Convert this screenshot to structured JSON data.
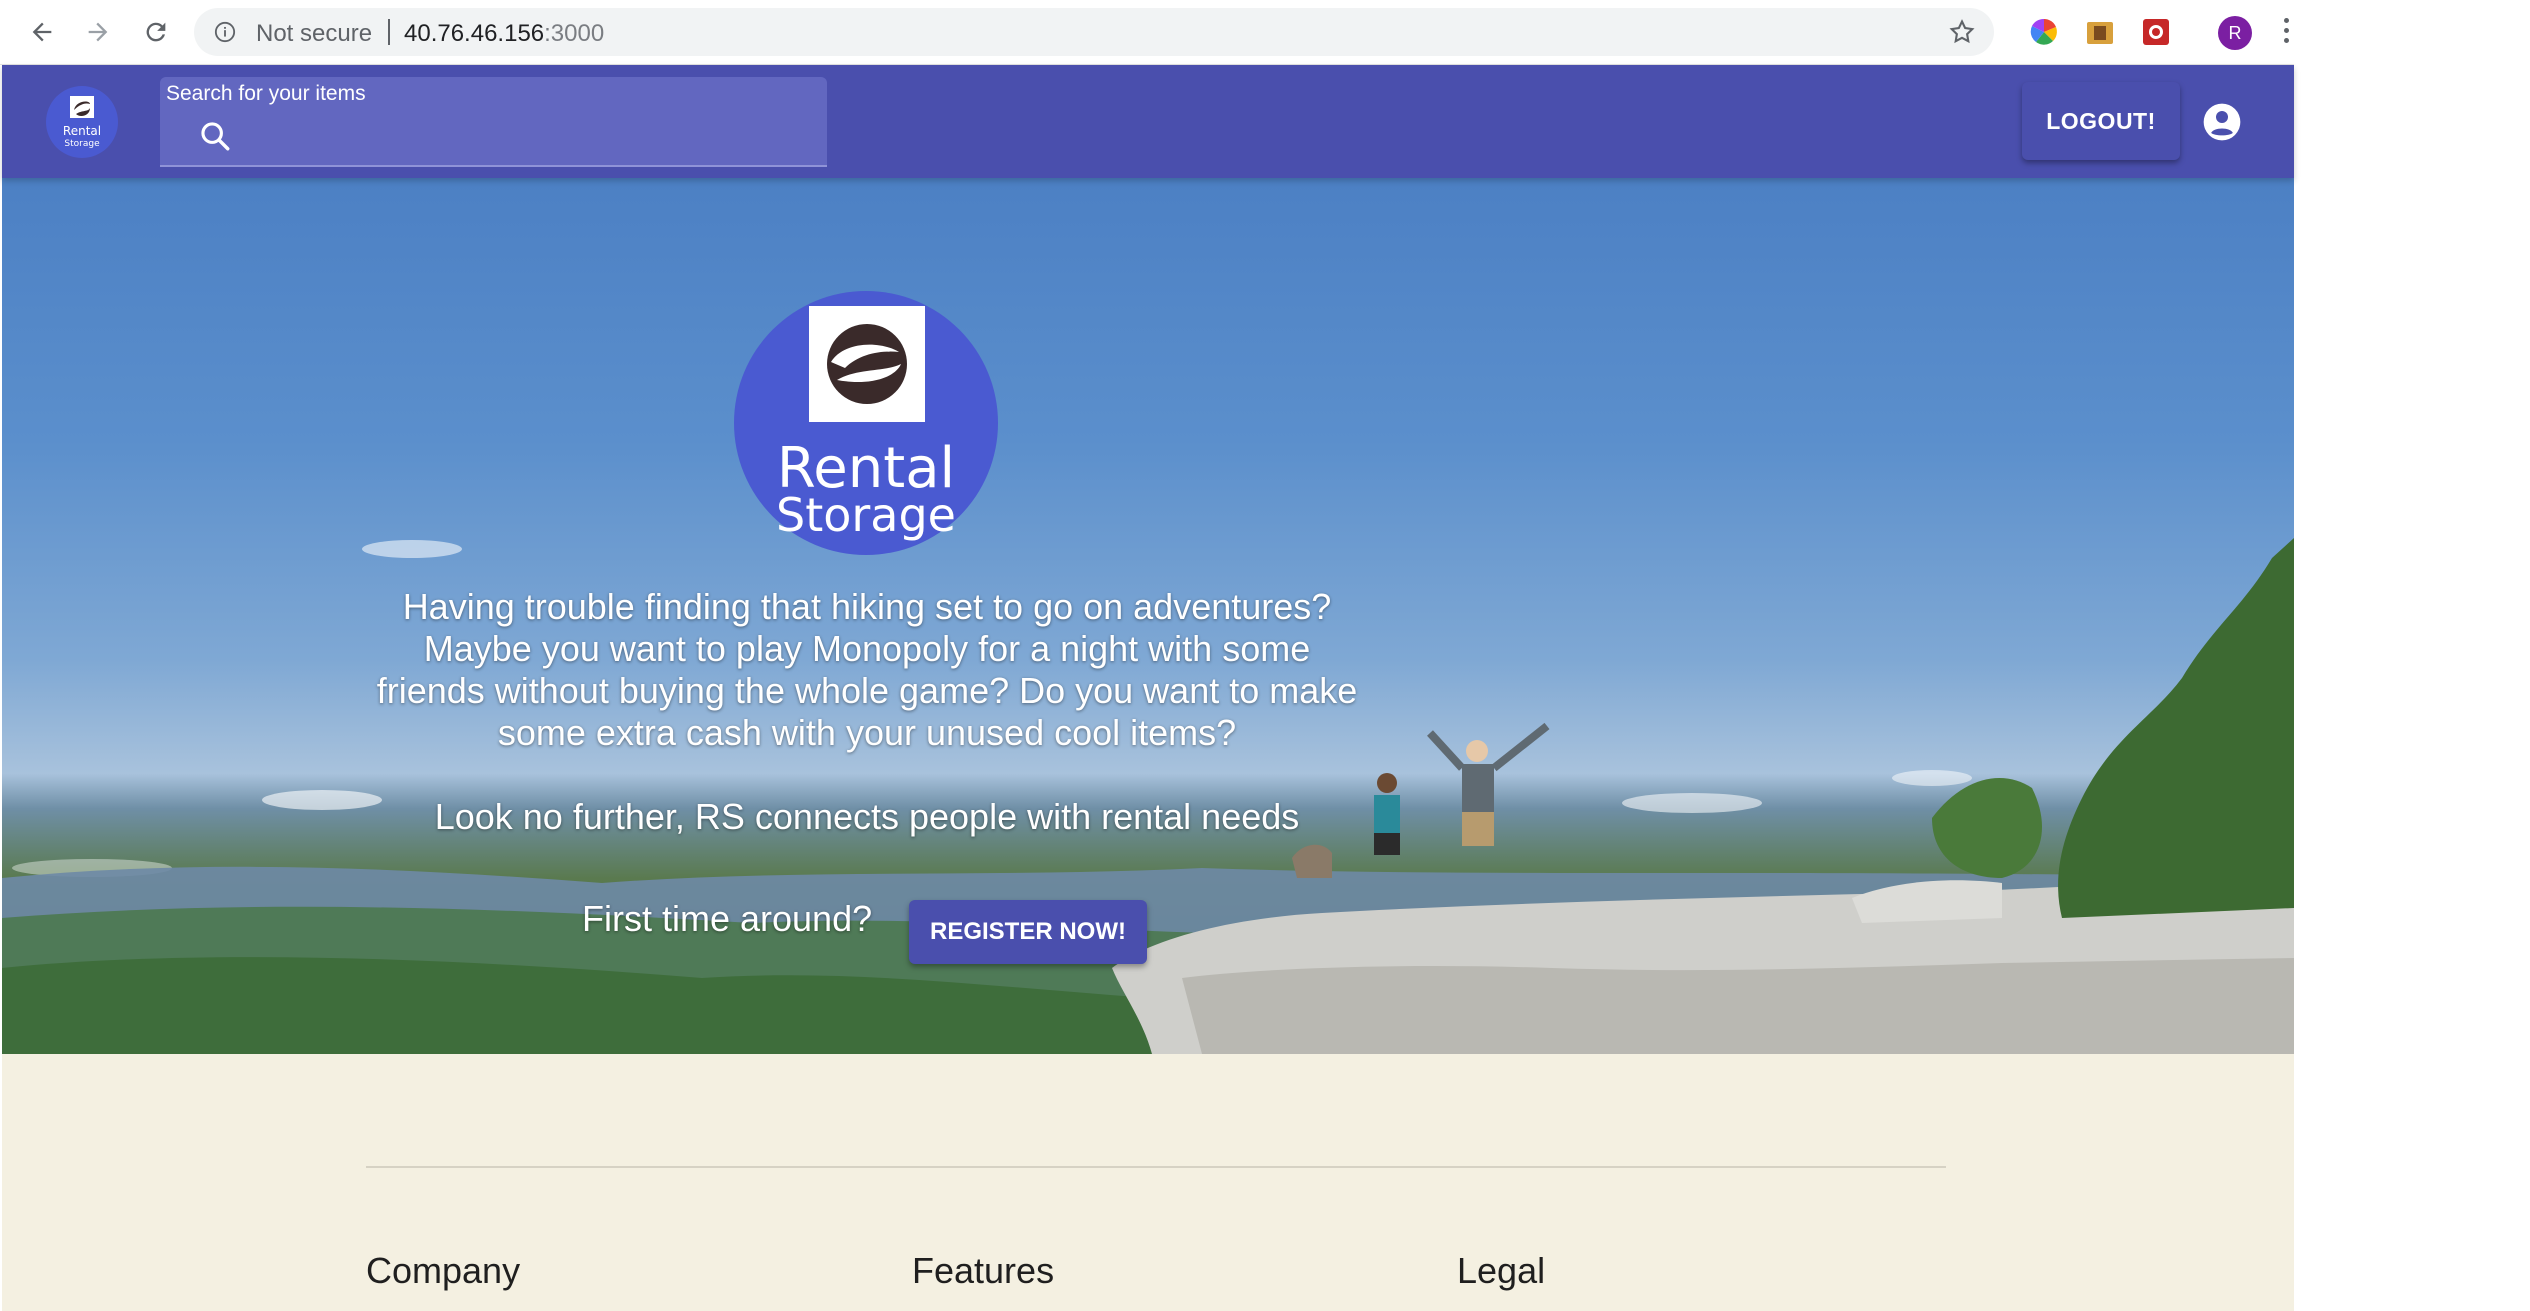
{
  "browser": {
    "security_label": "Not secure",
    "url_host": "40.76.46.156",
    "url_port": ":3000",
    "profile_initial": "R"
  },
  "app_bar": {
    "logo_text_line1": "Rental",
    "logo_text_line2": "Storage",
    "search_label": "Search for your items",
    "search_icon": "search-icon",
    "logout_label": "LOGOUT!",
    "account_icon": "account-circle-icon",
    "color": "#4a4fad"
  },
  "hero": {
    "logo_line1": "Rental",
    "logo_line2": "Storage",
    "text_lines": [
      "Having trouble finding that hiking set to go on adventures?",
      "Maybe you want to play Monopoly for a night with some",
      "friends without buying the whole game? Do you want to make",
      "some extra cash with your unused cool items?"
    ],
    "tagline": "Look no further, RS connects people with rental needs",
    "first_time": "First time around?",
    "register_label": "REGISTER NOW!"
  },
  "footer": {
    "columns": [
      "Company",
      "Features",
      "Legal"
    ],
    "background": "#f4f0e1"
  }
}
